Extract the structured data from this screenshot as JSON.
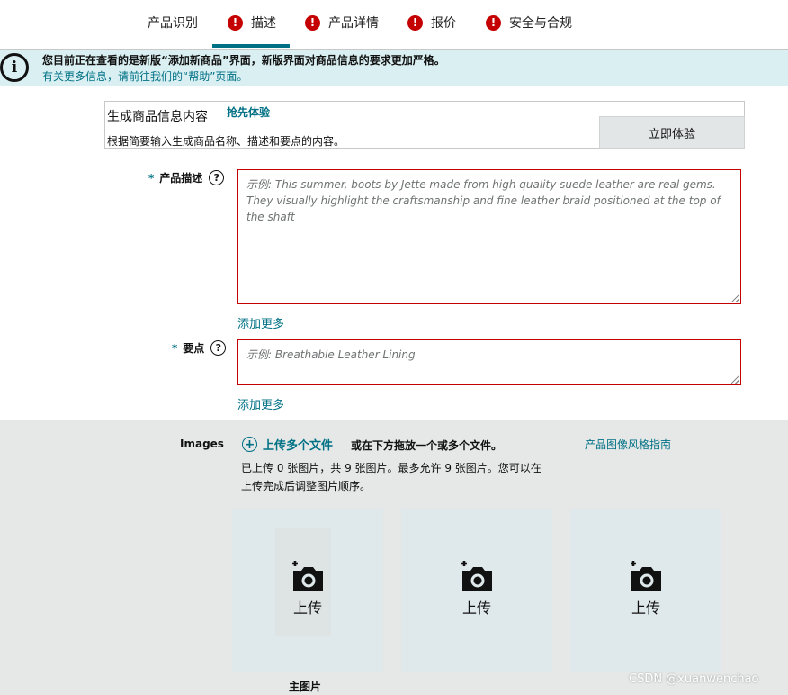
{
  "tabs": [
    {
      "label": "产品识别",
      "error": false
    },
    {
      "label": "描述",
      "error": true,
      "active": true
    },
    {
      "label": "产品详情",
      "error": true
    },
    {
      "label": "报价",
      "error": true
    },
    {
      "label": "安全与合规",
      "error": true
    }
  ],
  "banner": {
    "line1": "您目前正在查看的是新版“添加新商品”界面，新版界面对商品信息的要求更加严格。",
    "line2": "有关更多信息，请前往我们的“帮助”页面。"
  },
  "generate": {
    "title": "生成商品信息内容",
    "link": "抢先体验",
    "description": "根据简要输入生成商品名称、描述和要点的内容。",
    "button": "立即体验"
  },
  "description_field": {
    "label": "产品描述",
    "placeholder": "示例:   This summer, boots by Jette made from high quality suede leather are real gems. They visually highlight the craftsmanship and fine leather braid positioned at the top of the shaft",
    "add_more": "添加更多"
  },
  "bullet_field": {
    "label": "要点",
    "placeholder": "示例:   Breathable Leather Lining",
    "add_more": "添加更多"
  },
  "images": {
    "label": "Images",
    "upload_multi": "上传多个文件",
    "drag_hint": "或在下方拖放一个或多个文件。",
    "guide_link": "产品图像风格指南",
    "count_line1": "已上传 0 张图片，共 9 张图片。最多允许 9 张图片。您可以在",
    "count_line2": "上传完成后调整图片顺序。",
    "slots": [
      {
        "label": "上传"
      },
      {
        "label": "上传"
      },
      {
        "label": "上传"
      }
    ],
    "main_label": "主图片"
  },
  "watermark": "CSDN @xuanwenchao",
  "colors": {
    "accent": "#007185",
    "error": "#c40000",
    "banner_bg": "#d9eff2",
    "section_bg": "#e6e8e8"
  },
  "icons": [
    "error-icon",
    "info-icon",
    "help-icon",
    "plus-circle-icon",
    "camera-add-icon"
  ]
}
